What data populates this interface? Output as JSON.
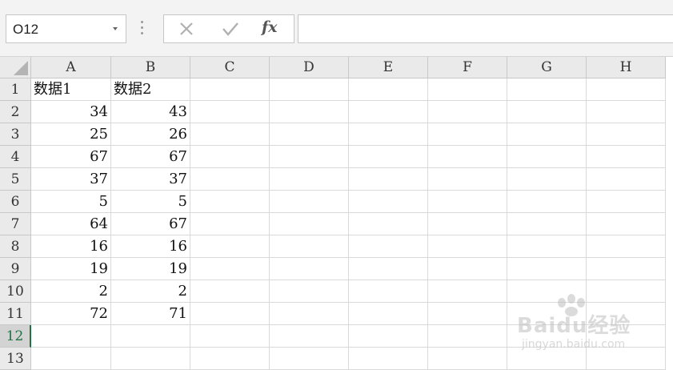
{
  "name_box": {
    "value": "O12"
  },
  "formula_bar": {
    "cancel_icon": "close-icon",
    "enter_icon": "check-icon",
    "function_label": "fx",
    "value": ""
  },
  "columns": [
    "A",
    "B",
    "C",
    "D",
    "E",
    "F",
    "G",
    "H"
  ],
  "rows": [
    "1",
    "2",
    "3",
    "4",
    "5",
    "6",
    "7",
    "8",
    "9",
    "10",
    "11",
    "12",
    "13"
  ],
  "active_row": "12",
  "cells": {
    "A1": "数据1",
    "B1": "数据2",
    "A2": "34",
    "B2": "43",
    "A3": "25",
    "B3": "26",
    "A4": "67",
    "B4": "67",
    "A5": "37",
    "B5": "37",
    "A6": "5",
    "B6": "5",
    "A7": "64",
    "B7": "67",
    "A8": "16",
    "B8": "16",
    "A9": "19",
    "B9": "19",
    "A10": "2",
    "B10": "2",
    "A11": "72",
    "B11": "71"
  },
  "watermark": {
    "text": "Baidu经验",
    "subtext": "jingyan.baidu.com"
  },
  "colors": {
    "accent": "#217346",
    "header_bg": "#eaeaea",
    "gridline": "#d9d9d9"
  }
}
